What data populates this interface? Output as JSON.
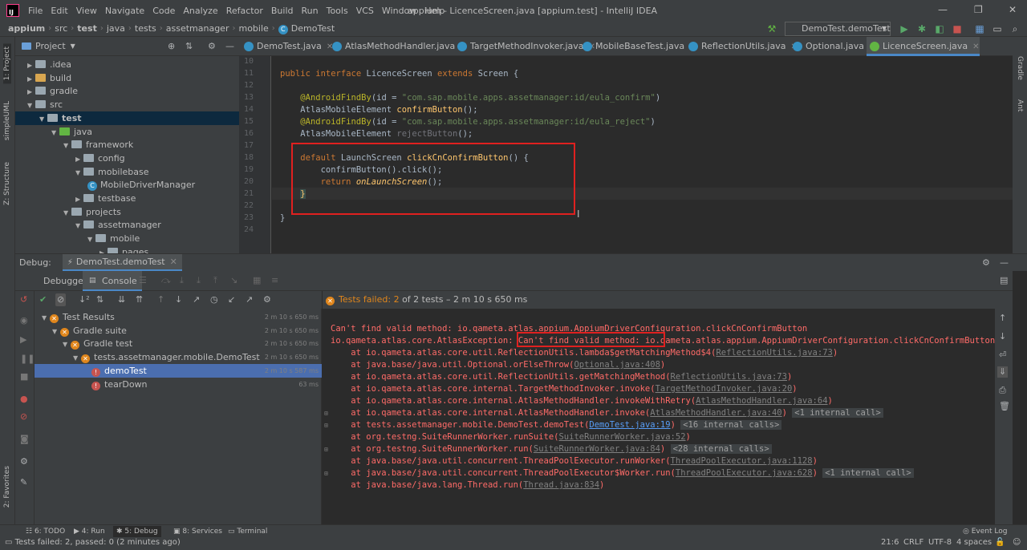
{
  "window": {
    "title": "appium - LicenceScreen.java [appium.test] - IntelliJ IDEA",
    "menu": [
      "File",
      "Edit",
      "View",
      "Navigate",
      "Code",
      "Analyze",
      "Refactor",
      "Build",
      "Run",
      "Tools",
      "VCS",
      "Window",
      "Help"
    ]
  },
  "breadcrumb": [
    "appium",
    "src",
    "test",
    "java",
    "tests",
    "assetmanager",
    "mobile",
    "DemoTest"
  ],
  "run_config": "DemoTest.demoTest",
  "left_strip": {
    "project": "1: Project",
    "simpleuml": "simpleUML",
    "structure": "Z: Structure",
    "favorites": "2: Favorites"
  },
  "right_strip": {
    "gradle": "Gradle",
    "ant": "Ant"
  },
  "project_panel": {
    "title": "Project",
    "tree": [
      {
        "label": ".idea",
        "indent": 1,
        "type": "folder"
      },
      {
        "label": "build",
        "indent": 1,
        "type": "orange"
      },
      {
        "label": "gradle",
        "indent": 1,
        "type": "folder"
      },
      {
        "label": "src",
        "indent": 1,
        "type": "folder"
      },
      {
        "label": "test",
        "indent": 2,
        "type": "folder"
      },
      {
        "label": "java",
        "indent": 3,
        "type": "green"
      },
      {
        "label": "framework",
        "indent": 4,
        "type": "folder"
      },
      {
        "label": "config",
        "indent": 5,
        "type": "folder"
      },
      {
        "label": "mobilebase",
        "indent": 5,
        "type": "folder"
      },
      {
        "label": "MobileDriverManager",
        "indent": 6,
        "type": "class"
      },
      {
        "label": "testbase",
        "indent": 5,
        "type": "folder"
      },
      {
        "label": "projects",
        "indent": 4,
        "type": "folder"
      },
      {
        "label": "assetmanager",
        "indent": 5,
        "type": "folder"
      },
      {
        "label": "mobile",
        "indent": 6,
        "type": "folder"
      },
      {
        "label": "pages",
        "indent": 7,
        "type": "folder"
      }
    ]
  },
  "tabs": [
    "DemoTest.java",
    "AtlasMethodHandler.java",
    "TargetMethodInvoker.java",
    "MobileBaseTest.java",
    "ReflectionUtils.java",
    "Optional.java",
    "LicenceScreen.java"
  ],
  "editor": {
    "line_numbers": [
      "10",
      "11",
      "12",
      "13",
      "14",
      "15",
      "16",
      "17",
      "18",
      "19",
      "20",
      "21",
      "22",
      "23",
      "24"
    ],
    "line11": {
      "kw1": "public",
      "kw2": "interface",
      "name": "LicenceScreen",
      "kw3": "extends",
      "rest": "Screen {"
    },
    "line13": {
      "ann": "@AndroidFindBy",
      "pre": "(id = ",
      "str": "\"com.sap.mobile.apps.assetmanager:id/eula_confirm\"",
      "post": ")"
    },
    "line14": {
      "type": "AtlasMobileElement ",
      "fn": "confirmButton",
      "post": "();"
    },
    "line15": {
      "ann": "@AndroidFindBy",
      "pre": "(id = ",
      "str": "\"com.sap.mobile.apps.assetmanager:id/eula_reject\"",
      "post": ")"
    },
    "line16": {
      "type": "AtlasMobileElement ",
      "fn": "rejectButton",
      "post": "();"
    },
    "line18": {
      "kw": "default ",
      "type": "LaunchScreen ",
      "fn": "clickCnConfirmButton",
      "post": "() {"
    },
    "line19": "confirmButton().click();",
    "line20": {
      "kw": "return ",
      "fn": "onLaunchScreen",
      "post": "();"
    },
    "line21": "}",
    "line23": "}"
  },
  "debug": {
    "label": "Debug:",
    "session": "DemoTest.demoTest",
    "tab_debugger": "Debugger",
    "tab_console": "Console",
    "status": {
      "prefix": "Tests failed: ",
      "count": "2",
      "rest": " of 2 tests – 2 m 10 s 650 ms"
    },
    "tests": [
      {
        "label": "Test Results",
        "time": "2 m 10 s 650 ms",
        "icon": "warn",
        "indent": 1
      },
      {
        "label": "Gradle suite",
        "time": "2 m 10 s 650 ms",
        "icon": "warn",
        "indent": 2
      },
      {
        "label": "Gradle test",
        "time": "2 m 10 s 650 ms",
        "icon": "warn",
        "indent": 3
      },
      {
        "label": "tests.assetmanager.mobile.DemoTest",
        "time": "2 m 10 s 650 ms",
        "icon": "warn",
        "indent": 4
      },
      {
        "label": "demoTest",
        "time": "2 m 10 s 587 ms",
        "icon": "err",
        "indent": 5,
        "selected": true
      },
      {
        "label": "tearDown",
        "time": "63 ms",
        "icon": "err",
        "indent": 5
      }
    ],
    "console": {
      "line1": "Can't find valid method: io.qameta.atlas.appium.AppiumDriverConfiguration.clickCnConfirmButton",
      "line2a": "io.qameta.atlas.core.AtlasException",
      "line2b": ": Can't find valid method: ",
      "line2c": "io.qameta.atlas.appium.AppiumDriverConfiguration.clickCnConfirmButton",
      "frames": [
        {
          "text": "    at io.qameta.atlas.core.util.ReflectionUtils.lambda$getMatchingMethod$4(",
          "link": "ReflectionUtils.java:73",
          "end": ")",
          "chip": ""
        },
        {
          "text": "    at java.base/java.util.Optional.orElseThrow(",
          "link": "Optional.java:408",
          "end": ")",
          "chip": ""
        },
        {
          "text": "    at io.qameta.atlas.core.util.ReflectionUtils.getMatchingMethod(",
          "link": "ReflectionUtils.java:73",
          "end": ")",
          "chip": ""
        },
        {
          "text": "    at io.qameta.atlas.core.internal.TargetMethodInvoker.invoke(",
          "link": "TargetMethodInvoker.java:20",
          "end": ")",
          "chip": ""
        },
        {
          "text": "    at io.qameta.atlas.core.internal.AtlasMethodHandler.invokeWithRetry(",
          "link": "AtlasMethodHandler.java:64",
          "end": ")",
          "chip": ""
        },
        {
          "text": "    at io.qameta.atlas.core.internal.AtlasMethodHandler.invoke(",
          "link": "AtlasMethodHandler.java:40",
          "end": ")",
          "chip": "<1 internal call>"
        },
        {
          "text": "    at tests.assetmanager.mobile.DemoTest.demoTest(",
          "link": "DemoTest.java:19",
          "end": ")",
          "chip": "<16 internal calls>",
          "blue": true
        },
        {
          "text": "    at org.testng.SuiteRunnerWorker.runSuite(",
          "link": "SuiteRunnerWorker.java:52",
          "end": ")",
          "chip": ""
        },
        {
          "text": "    at org.testng.SuiteRunnerWorker.run(",
          "link": "SuiteRunnerWorker.java:84",
          "end": ")",
          "chip": "<28 internal calls>"
        },
        {
          "text": "    at java.base/java.util.concurrent.ThreadPoolExecutor.runWorker(",
          "link": "ThreadPoolExecutor.java:1128",
          "end": ")",
          "chip": ""
        },
        {
          "text": "    at java.base/java.util.concurrent.ThreadPoolExecutor$Worker.run(",
          "link": "ThreadPoolExecutor.java:628",
          "end": ")",
          "chip": "<1 internal call>"
        },
        {
          "text": "    at java.base/java.lang.Thread.run(",
          "link": "Thread.java:834",
          "end": ")",
          "chip": ""
        }
      ]
    }
  },
  "bottom_tabs": [
    "6: TODO",
    "4: Run",
    "5: Debug",
    "8: Services",
    "Terminal"
  ],
  "event_log": "Event Log",
  "status_bar": {
    "message": "Tests failed: 2, passed: 0 (2 minutes ago)",
    "position": "21:6",
    "line_sep": "CRLF",
    "encoding": "UTF-8",
    "indent": "4 spaces"
  },
  "colors": {
    "accent": "#4a88c7",
    "highlight_box": "#e0201f",
    "error_text": "#ff6b68"
  }
}
